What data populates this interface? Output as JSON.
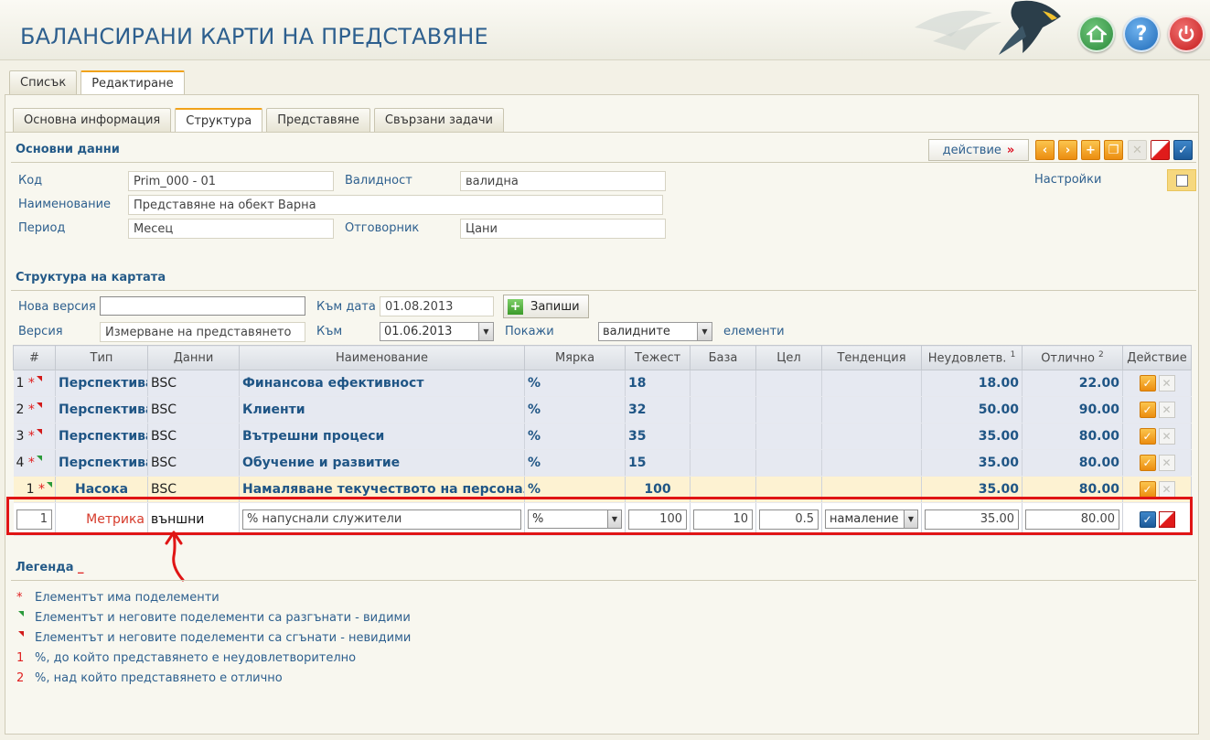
{
  "app": {
    "title": "БАЛАНСИРАНИ КАРТИ НА ПРЕДСТАВЯНЕ",
    "header_icons": [
      "home-icon",
      "help-icon",
      "power-icon"
    ]
  },
  "main_tabs": [
    {
      "label": "Списък",
      "active": false
    },
    {
      "label": "Редактиране",
      "active": true
    }
  ],
  "sub_tabs": [
    {
      "label": "Основна информация",
      "active": false
    },
    {
      "label": "Структура",
      "active": true
    },
    {
      "label": "Представяне",
      "active": false
    },
    {
      "label": "Свързани задачи",
      "active": false
    }
  ],
  "basic": {
    "title": "Основни данни",
    "action_label": "действие",
    "action_suffix": "»",
    "code_label": "Код",
    "code_value": "Prim_000 - 01",
    "validity_label": "Валидност",
    "validity_value": "валидна",
    "name_label": "Наименование",
    "name_value": "Представяне на обект Варна",
    "period_label": "Период",
    "period_value": "Месец",
    "owner_label": "Отговорник",
    "owner_value": "Цани",
    "settings_label": "Настройки"
  },
  "structure": {
    "title": "Структура на картата",
    "new_version_label": "Нова версия",
    "new_version_value": "",
    "to_date_label": "Към дата",
    "to_date_value": "01.08.2013",
    "save_label": "Запиши",
    "version_label": "Версия",
    "version_value": "Измерване на представянето",
    "to_label": "Към",
    "to_value": "01.06.2013",
    "show_label": "Покажи",
    "show_value": "валидните",
    "elements_label": "елементи"
  },
  "table": {
    "headers": [
      "#",
      "Тип",
      "Данни",
      "Наименование",
      "Мярка",
      "Тежест",
      "База",
      "Цел",
      "Тенденция",
      "Неудовлетв.",
      "Отлично",
      "Действие"
    ],
    "header_sup_unsat": "1",
    "header_sup_exc": "2",
    "rows": [
      {
        "num": "1",
        "type": "Перспектива",
        "data": "BSC",
        "name": "Финансова ефективност",
        "unit": "%",
        "weight": "18",
        "base": "",
        "target": "",
        "trend": "",
        "unsat": "18.00",
        "exc": "22.00"
      },
      {
        "num": "2",
        "type": "Перспектива",
        "data": "BSC",
        "name": "Клиенти",
        "unit": "%",
        "weight": "32",
        "base": "",
        "target": "",
        "trend": "",
        "unsat": "50.00",
        "exc": "90.00"
      },
      {
        "num": "3",
        "type": "Перспектива",
        "data": "BSC",
        "name": "Вътрешни процеси",
        "unit": "%",
        "weight": "35",
        "base": "",
        "target": "",
        "trend": "",
        "unsat": "35.00",
        "exc": "80.00"
      },
      {
        "num": "4",
        "type": "Перспектива",
        "data": "BSC",
        "name": "Обучение и развитие",
        "unit": "%",
        "weight": "15",
        "base": "",
        "target": "",
        "trend": "",
        "unsat": "35.00",
        "exc": "80.00"
      }
    ],
    "nasoka": {
      "num": "1",
      "type": "Насока",
      "data": "BSC",
      "name": "Намаляване текучеството на персонала",
      "unit": "%",
      "weight": "100",
      "unsat": "35.00",
      "exc": "80.00"
    },
    "edit_row": {
      "num": "1",
      "type": "Метрика",
      "data": "външни",
      "name": "% напуснали служители",
      "unit": "%",
      "weight": "100",
      "base": "10",
      "target": "0.5",
      "trend": "намаление",
      "unsat": "35.00",
      "exc": "80.00"
    }
  },
  "legend": {
    "title": "Легенда",
    "title_suffix": "_",
    "items": [
      {
        "mark": "*",
        "text": "Елементът има поделементи"
      },
      {
        "mark": "",
        "text": "Елементът и неговите поделементи са разгънати - видими"
      },
      {
        "mark": "",
        "text": "Елементът и неговите поделементи са сгънати - невидими"
      },
      {
        "mark": "1",
        "text": "%, до който представянето е неудовлетворително"
      },
      {
        "mark": "2",
        "text": "%, над който представянето е отлично"
      }
    ]
  },
  "colors": {
    "accent": "#2d5f8e",
    "highlight": "#e01515",
    "tab_active": "#f0a21a"
  }
}
